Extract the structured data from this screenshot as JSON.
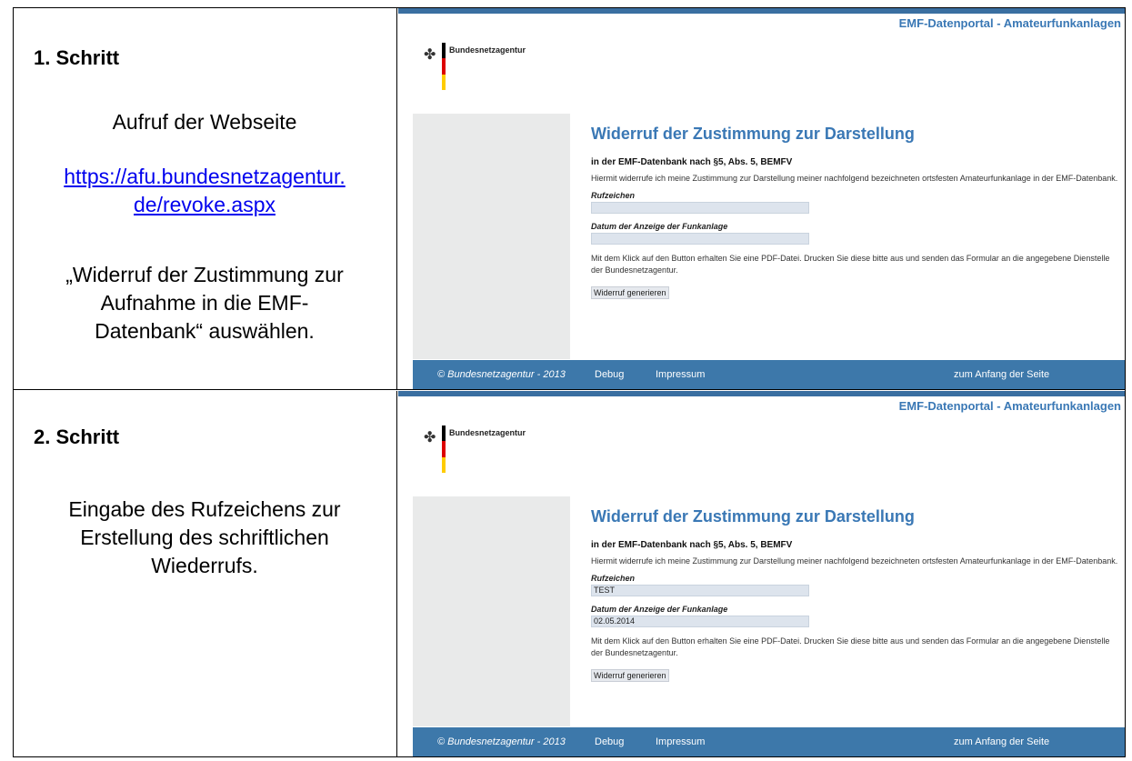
{
  "steps": [
    {
      "title": "1. Schritt",
      "text_1": "Aufruf der Webseite",
      "link_line_1": "https://afu.bundesnetzagentur.",
      "link_line_2": "de/revoke.aspx",
      "text_2_line_1": "„Widerruf der Zustimmung  zur",
      "text_2_line_2": "Aufnahme in die EMF-",
      "text_2_line_3": "Datenbank“  auswählen.",
      "shot": {
        "portal_title": "EMF-Datenportal - Amateurfunkanlagen",
        "brand": "Bundesnetzagentur",
        "heading": "Widerruf der Zustimmung zur Darstellung",
        "subheading": "in der EMF-Datenbank nach §5, Abs. 5, BEMFV",
        "intro": "Hiermit widerrufe ich meine Zustimmung zur Darstellung meiner nachfolgend bezeichneten ortsfesten Amateurfunkanlage in der EMF-Datenbank.",
        "label_callsign": "Rufzeichen",
        "value_callsign": "",
        "label_date": "Datum der Anzeige der Funkanlage",
        "value_date": "",
        "info": "Mit dem Klick auf den Button erhalten Sie eine PDF-Datei. Drucken Sie diese bitte aus und senden das Formular an die angegebene Dienstelle der Bundesnetzagentur.",
        "button": "Widerruf generieren",
        "footer_copy": "© Bundesnetzagentur - 2013",
        "footer_debug": "Debug",
        "footer_impressum": "Impressum",
        "footer_top": "zum Anfang der Seite"
      }
    },
    {
      "title": "2. Schritt",
      "text_1_line_1": "Eingabe des Rufzeichens zur",
      "text_1_line_2": "Erstellung des schriftlichen",
      "text_1_line_3": "Wiederrufs.",
      "shot": {
        "portal_title": "EMF-Datenportal - Amateurfunkanlagen",
        "brand": "Bundesnetzagentur",
        "heading": "Widerruf der Zustimmung zur Darstellung",
        "subheading": "in der EMF-Datenbank nach §5, Abs. 5, BEMFV",
        "intro": "Hiermit widerrufe ich meine Zustimmung zur Darstellung meiner nachfolgend bezeichneten ortsfesten Amateurfunkanlage in der EMF-Datenbank.",
        "label_callsign": "Rufzeichen",
        "value_callsign": "TEST",
        "label_date": "Datum der Anzeige der Funkanlage",
        "value_date": "02.05.2014",
        "info": "Mit dem Klick auf den Button erhalten Sie eine PDF-Datei. Drucken Sie diese bitte aus und senden das Formular an die angegebene Dienstelle der Bundesnetzagentur.",
        "button": "Widerruf generieren",
        "footer_copy": "© Bundesnetzagentur - 2013",
        "footer_debug": "Debug",
        "footer_impressum": "Impressum",
        "footer_top": "zum Anfang der Seite"
      }
    }
  ],
  "colors": {
    "accent_blue": "#3a78b5",
    "footer_blue": "#3d78aa",
    "link_blue": "#0000ee",
    "field_bg": "#dde4ed"
  }
}
